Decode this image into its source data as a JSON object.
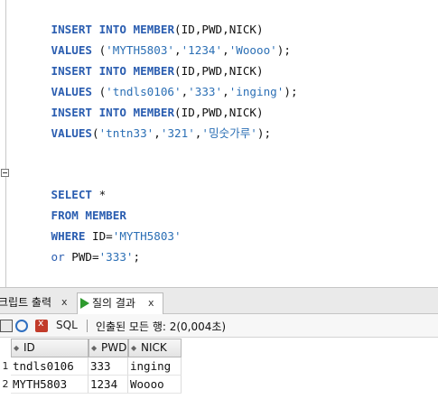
{
  "editor": {
    "lines": [
      {
        "kw1": "INSERT",
        "kw2": "INTO",
        "kw3": "MEMBER",
        "rest": "(ID,PWD,NICK)"
      },
      {
        "kw1": "VALUES",
        "open": " (",
        "v1": "'MYTH5803'",
        "c1": ",",
        "v2": "'1234'",
        "c2": ",",
        "v3": "'Woooo'",
        "close": ");"
      },
      {
        "kw1": "INSERT",
        "kw2": "INTO",
        "kw3": "MEMBER",
        "rest": "(ID,PWD,NICK)"
      },
      {
        "kw1": "VALUES",
        "open": " (",
        "v1": "'tndls0106'",
        "c1": ",",
        "v2": "'333'",
        "c2": ",",
        "v3": "'inging'",
        "close": ");"
      },
      {
        "kw1": "INSERT",
        "kw2": "INTO",
        "kw3": "MEMBER",
        "rest": "(ID,PWD,NICK)"
      },
      {
        "kw1": "VALUES",
        "open": "(",
        "v1": "'tntn33'",
        "c1": ",",
        "v2": "'321'",
        "c2": ",",
        "v3": "'밍숫가루'",
        "close": ");"
      }
    ],
    "select": {
      "kw_select": "SELECT",
      "star": " *",
      "kw_from": "FROM",
      "table": " MEMBER",
      "kw_where": "WHERE",
      "where_col": " ID=",
      "where_val": "'MYTH5803'",
      "kw_or": "or",
      "or_col": " PWD=",
      "or_val": "'333'",
      "end": ";"
    }
  },
  "tabs": {
    "script_output": "크립트 출력",
    "query_result": "질의 결과",
    "close": "x"
  },
  "toolbar": {
    "sql": "SQL",
    "status": "인출된 모든 행: 2(0,004초)"
  },
  "grid": {
    "columns": [
      "ID",
      "PWD",
      "NICK"
    ],
    "rows": [
      {
        "num": "1",
        "id": "tndls0106",
        "pwd": "333",
        "nick": "inging"
      },
      {
        "num": "2",
        "id": "MYTH5803",
        "pwd": "1234",
        "nick": "Woooo"
      }
    ]
  }
}
